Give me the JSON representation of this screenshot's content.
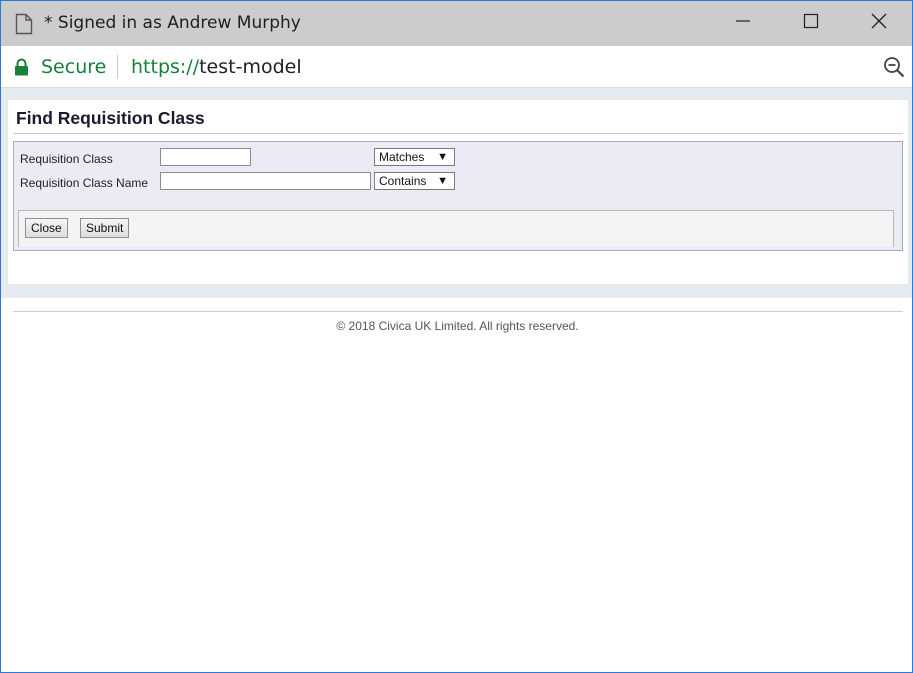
{
  "window": {
    "title": "* Signed in as Andrew Murphy",
    "controls": {
      "minimize": "minimize-icon",
      "maximize": "maximize-icon",
      "close": "close-icon"
    }
  },
  "address_bar": {
    "security_label": "Secure",
    "url_scheme": "https://",
    "url_host": "test-model",
    "icons": {
      "lock": "lock-icon",
      "zoom": "zoom-out-icon"
    }
  },
  "page": {
    "title": "Find Requisition Class",
    "fields": [
      {
        "label": "Requisition Class",
        "value": "",
        "operator": "Matches"
      },
      {
        "label": "Requisition Class Name",
        "value": "",
        "operator": "Contains"
      }
    ],
    "buttons": {
      "close": "Close",
      "submit": "Submit"
    }
  },
  "footer": {
    "copyright": "© 2018 Civica UK Limited. All rights reserved."
  },
  "colors": {
    "titlebar": "#cccccc",
    "secure_green": "#188038",
    "form_bg": "#ebebf5",
    "window_border": "#2b79d8"
  }
}
